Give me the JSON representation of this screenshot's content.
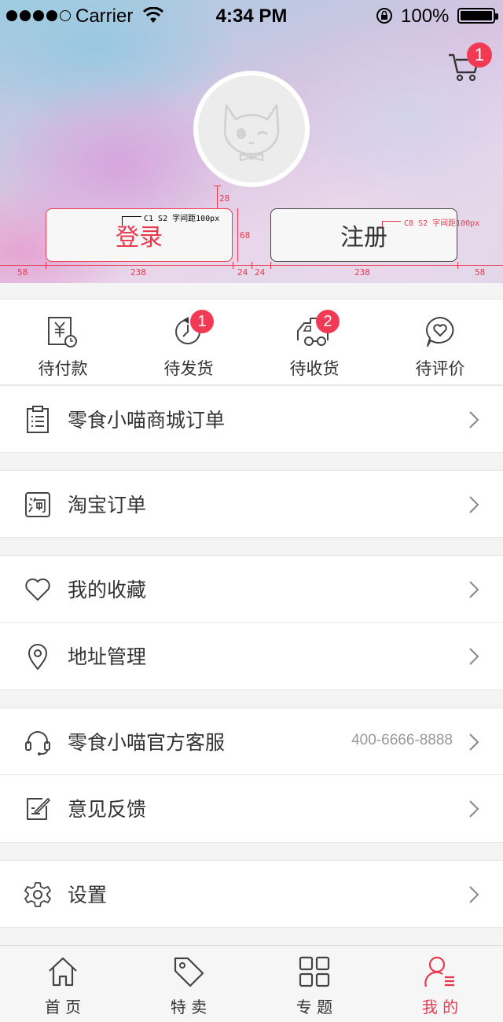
{
  "status_bar": {
    "carrier": "Carrier",
    "time": "4:34 PM",
    "battery": "100%"
  },
  "header": {
    "cart_badge": "1",
    "login_label": "登录",
    "register_label": "注册",
    "annotations": {
      "login_note": "C1 S2 字间距100px",
      "register_note": "C8 S2 字间距100px",
      "gap_top": "28",
      "button_height": "68",
      "margin_left": "58",
      "button_width_left": "238",
      "gap_left": "24",
      "gap_right": "24",
      "button_width_right": "238",
      "margin_right": "58"
    }
  },
  "order_status": [
    {
      "label": "待付款",
      "icon": "payment-icon",
      "badge": ""
    },
    {
      "label": "待发货",
      "icon": "shipping-icon",
      "badge": "1"
    },
    {
      "label": "待收货",
      "icon": "truck-icon",
      "badge": "2"
    },
    {
      "label": "待评价",
      "icon": "review-icon",
      "badge": ""
    }
  ],
  "menu": {
    "mall_orders": "零食小喵商城订单",
    "taobao_orders": "淘宝订单",
    "favorites": "我的收藏",
    "address": "地址管理",
    "customer_service": "零食小喵官方客服",
    "customer_service_phone": "400-6666-8888",
    "feedback": "意见反馈",
    "settings": "设置"
  },
  "tabbar": [
    {
      "label": "首 页",
      "icon": "home-icon",
      "active": false
    },
    {
      "label": "特 卖",
      "icon": "tag-icon",
      "active": false
    },
    {
      "label": "专 题",
      "icon": "grid-icon",
      "active": false
    },
    {
      "label": "我 的",
      "icon": "profile-icon",
      "active": true
    }
  ],
  "colors": {
    "accent": "#e8394f",
    "badge": "#f33a55",
    "text": "#333333",
    "muted": "#999999"
  }
}
